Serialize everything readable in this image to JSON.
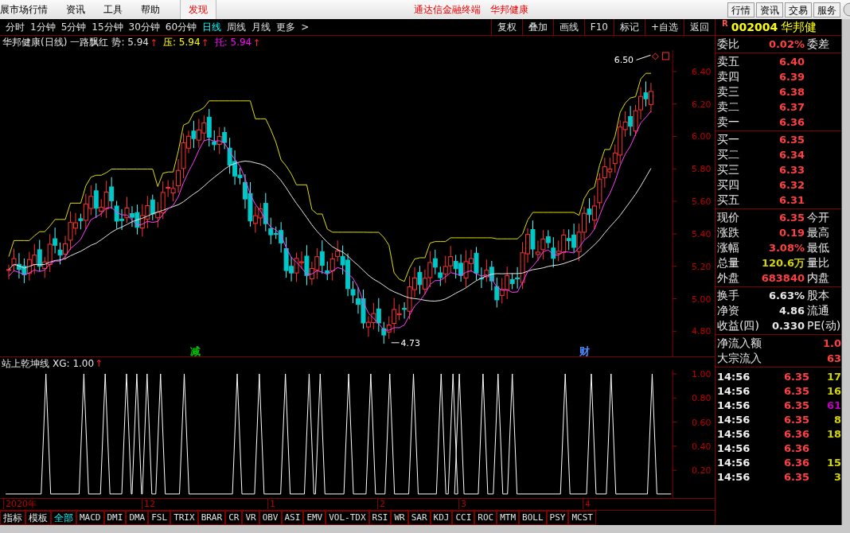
{
  "menu_bar": {
    "items": [
      "展市场行情",
      "资讯",
      "工具",
      "帮助"
    ],
    "discover_tab": "发现",
    "title_parts": [
      "通达信金融终端",
      "华邦健康"
    ],
    "buttons": [
      "行情",
      "资讯",
      "交易",
      "服务"
    ]
  },
  "period_tabs": [
    {
      "label": "分时",
      "selected": false
    },
    {
      "label": "1分钟",
      "selected": false
    },
    {
      "label": "5分钟",
      "selected": false
    },
    {
      "label": "15分钟",
      "selected": false
    },
    {
      "label": "30分钟",
      "selected": false
    },
    {
      "label": "60分钟",
      "selected": false
    },
    {
      "label": "日线",
      "selected": true
    },
    {
      "label": "周线",
      "selected": false
    },
    {
      "label": "月线",
      "selected": false
    },
    {
      "label": "更多",
      "selected": false
    }
  ],
  "more_chevron": ">",
  "tool_buttons": [
    "复权",
    "叠加",
    "画线",
    "F10",
    "标记",
    "+自选",
    "返回"
  ],
  "chart_title": {
    "name": "华邦健康(日线)",
    "formula": "一路飘红",
    "indicators": [
      {
        "label": "势:",
        "value": "5.94",
        "arrow": "↑",
        "color": "#e0e0e0"
      },
      {
        "label": "压:",
        "value": "5.94",
        "arrow": "↑",
        "color": "#ffff00"
      },
      {
        "label": "托:",
        "value": "5.94",
        "arrow": "↑",
        "color": "#ff00ff"
      }
    ]
  },
  "price_axis": [
    "6.40",
    "6.20",
    "6.00",
    "5.80",
    "5.60",
    "5.40",
    "5.20",
    "5.00",
    "4.80"
  ],
  "price_notes": [
    {
      "kind": "high",
      "label": "6.50"
    },
    {
      "kind": "low",
      "label": "4.73"
    }
  ],
  "event_marks": [
    {
      "label": "减",
      "color": "#00c000"
    },
    {
      "label": "财",
      "color": "#4a8cff"
    }
  ],
  "indicator_title": {
    "name": "站上乾坤线",
    "reading": "XG: 1.00",
    "arrow": "↑"
  },
  "indicator_axis": [
    "1.00",
    "0.80",
    "0.60",
    "0.40",
    "0.20"
  ],
  "date_axis": [
    "2020年",
    "12",
    "1",
    "2",
    "3",
    "4"
  ],
  "bottom_tabs": [
    {
      "label": "指标",
      "selected": false
    },
    {
      "label": "模板",
      "selected": false
    },
    {
      "label": "全部",
      "selected": true
    },
    {
      "label": "MACD",
      "selected": false
    },
    {
      "label": "DMI",
      "selected": false
    },
    {
      "label": "DMA",
      "selected": false
    },
    {
      "label": "FSL",
      "selected": false
    },
    {
      "label": "TRIX",
      "selected": false
    },
    {
      "label": "BRAR",
      "selected": false
    },
    {
      "label": "CR",
      "selected": false
    },
    {
      "label": "VR",
      "selected": false
    },
    {
      "label": "OBV",
      "selected": false
    },
    {
      "label": "ASI",
      "selected": false
    },
    {
      "label": "EMV",
      "selected": false
    },
    {
      "label": "VOL-TDX",
      "selected": false
    },
    {
      "label": "RSI",
      "selected": false
    },
    {
      "label": "WR",
      "selected": false
    },
    {
      "label": "SAR",
      "selected": false
    },
    {
      "label": "KDJ",
      "selected": false
    },
    {
      "label": "CCI",
      "selected": false
    },
    {
      "label": "ROC",
      "selected": false
    },
    {
      "label": "MTM",
      "selected": false
    },
    {
      "label": "BOLL",
      "selected": false
    },
    {
      "label": "PSY",
      "selected": false
    },
    {
      "label": "MCST",
      "selected": false
    }
  ],
  "quote": {
    "badge": "R",
    "code": "002004",
    "name": "华邦健",
    "ratio": {
      "label": "委比",
      "value": "0.02%",
      "label2": "委差"
    },
    "sell": [
      {
        "label": "卖五",
        "price": "6.40"
      },
      {
        "label": "卖四",
        "price": "6.39"
      },
      {
        "label": "卖三",
        "price": "6.38"
      },
      {
        "label": "卖二",
        "price": "6.37"
      },
      {
        "label": "卖一",
        "price": "6.36"
      }
    ],
    "buy": [
      {
        "label": "买一",
        "price": "6.35"
      },
      {
        "label": "买二",
        "price": "6.34"
      },
      {
        "label": "买三",
        "price": "6.33"
      },
      {
        "label": "买四",
        "price": "6.32"
      },
      {
        "label": "买五",
        "price": "6.31"
      }
    ],
    "stats": [
      {
        "label": "现价",
        "value": "6.35",
        "label2": "今开",
        "color": "#ff4040"
      },
      {
        "label": "涨跌",
        "value": "0.19",
        "label2": "最高",
        "color": "#ff4040"
      },
      {
        "label": "涨幅",
        "value": "3.08%",
        "label2": "最低",
        "color": "#ff4040"
      },
      {
        "label": "总量",
        "value": "120.6万",
        "label2": "量比",
        "color": "#d4d400"
      },
      {
        "label": "外盘",
        "value": "683840",
        "label2": "内盘",
        "color": "#ff4040"
      }
    ],
    "stats2": [
      {
        "label": "换手",
        "value": "6.63%",
        "label2": "股本"
      },
      {
        "label": "净资",
        "value": "4.86",
        "label2": "流通"
      },
      {
        "label": "收益(四)",
        "value": "0.330",
        "label2": "PE(动)"
      }
    ],
    "flows": [
      {
        "label": "净流入额",
        "value": "1.0"
      },
      {
        "label": "大宗流入",
        "value": "63"
      }
    ],
    "trades": [
      {
        "time": "14:56",
        "price": "6.35",
        "volume": "17",
        "color": "#d4d400"
      },
      {
        "time": "14:56",
        "price": "6.35",
        "volume": "16",
        "color": "#d4d400"
      },
      {
        "time": "14:56",
        "price": "6.35",
        "volume": "61",
        "color": "#c000c0"
      },
      {
        "time": "14:56",
        "price": "6.35",
        "volume": "8",
        "color": "#d4d400"
      },
      {
        "time": "14:56",
        "price": "6.36",
        "volume": "18",
        "color": "#d4d400"
      },
      {
        "time": "14:56",
        "price": "6.36"
      },
      {
        "time": "14:56",
        "price": "6.36",
        "volume": "15",
        "color": "#d4d400"
      },
      {
        "time": "14:56",
        "price": "6.35",
        "volume": "3",
        "color": "#d4d400"
      }
    ]
  }
}
